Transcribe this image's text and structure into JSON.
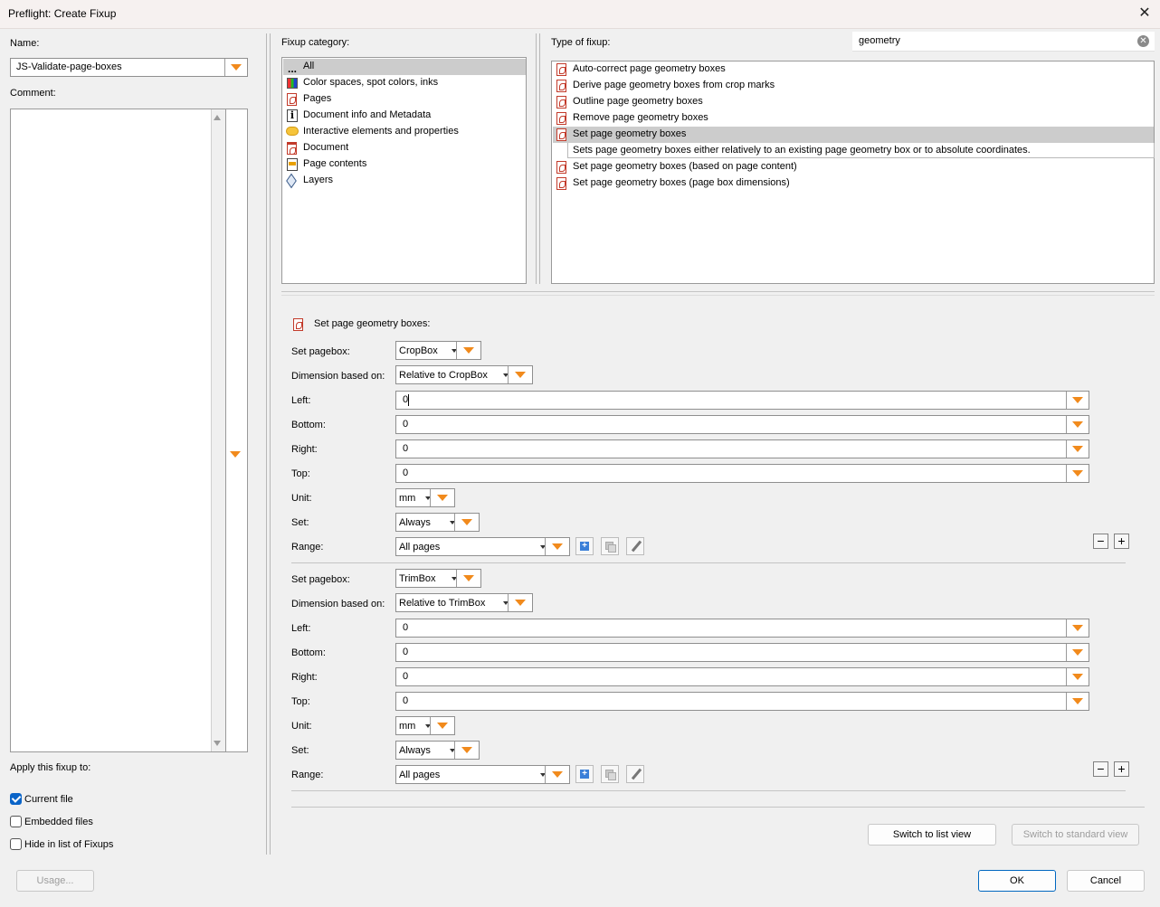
{
  "window": {
    "title": "Preflight: Create Fixup",
    "close_glyph": "✕"
  },
  "left": {
    "name_label": "Name:",
    "name_value": "JS-Validate-page-boxes",
    "comment_label": "Comment:",
    "apply_label": "Apply this fixup to:",
    "checkboxes": [
      {
        "label": "Current file",
        "checked": true
      },
      {
        "label": "Embedded files",
        "checked": false
      },
      {
        "label": "Hide in list of Fixups",
        "checked": false
      }
    ],
    "usage_button": "Usage..."
  },
  "category": {
    "label": "Fixup category:",
    "items": [
      {
        "label": "All",
        "icon": "dots-icon",
        "selected": true
      },
      {
        "label": "Color spaces, spot colors, inks",
        "icon": "color-icon"
      },
      {
        "label": "Pages",
        "icon": "pdf-icon"
      },
      {
        "label": "Document info and Metadata",
        "icon": "info-icon"
      },
      {
        "label": "Interactive elements and properties",
        "icon": "comment-icon"
      },
      {
        "label": "Document",
        "icon": "document-icon"
      },
      {
        "label": "Page contents",
        "icon": "page-contents-icon"
      },
      {
        "label": "Layers",
        "icon": "layers-icon"
      }
    ]
  },
  "fixup_type": {
    "label": "Type of fixup:",
    "search_value": "geometry",
    "items": [
      {
        "label": "Auto-correct page geometry boxes"
      },
      {
        "label": "Derive page geometry boxes from crop marks"
      },
      {
        "label": "Outline page geometry boxes"
      },
      {
        "label": "Remove page geometry boxes"
      },
      {
        "label": "Set page geometry boxes",
        "selected": true
      },
      {
        "label": "Set page geometry boxes (based on page content)"
      },
      {
        "label": "Set page geometry boxes (page box dimensions)"
      }
    ],
    "tooltip": "Sets page geometry boxes either relatively to an existing page geometry box or to absolute coordinates."
  },
  "settings": {
    "heading": "Set page geometry boxes:",
    "labels": {
      "pagebox": "Set pagebox:",
      "dimension": "Dimension based on:",
      "left": "Left:",
      "bottom": "Bottom:",
      "right": "Right:",
      "top": "Top:",
      "unit": "Unit:",
      "set": "Set:",
      "range": "Range:"
    },
    "groups": [
      {
        "pagebox": "CropBox",
        "dimension": "Relative to CropBox",
        "left": "0",
        "bottom": "0",
        "right": "0",
        "top": "0",
        "unit": "mm",
        "set": "Always",
        "range": "All pages"
      },
      {
        "pagebox": "TrimBox",
        "dimension": "Relative to TrimBox",
        "left": "0",
        "bottom": "0",
        "right": "0",
        "top": "0",
        "unit": "mm",
        "set": "Always",
        "range": "All pages"
      }
    ],
    "minus": "−",
    "plus": "+"
  },
  "footer": {
    "switch_list": "Switch to list view",
    "switch_standard": "Switch to standard view",
    "ok": "OK",
    "cancel": "Cancel"
  },
  "colors": {
    "accent": "#f18a1c",
    "selection": "#cccccc",
    "checkbox": "#0a64c8"
  }
}
